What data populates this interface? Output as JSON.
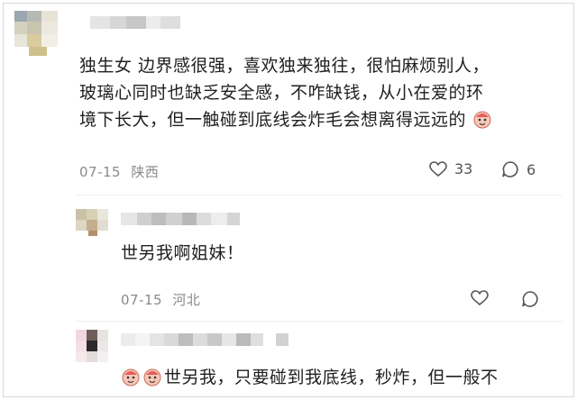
{
  "comment1": {
    "lines": [
      "独生女 边界感很强，喜欢独来独往，很怕麻烦别人，",
      "玻璃心同时也缺乏安全感，不咋缺钱，从小在爱的环",
      "境下长大，但一触碰到底线会炸毛会想离得远远的"
    ],
    "emoji": "face-emoji",
    "date": "07-15",
    "location": "陕西",
    "like_icon": "heart-icon",
    "like_count": "33",
    "reply_icon": "comment-bubble-icon",
    "reply_count": "6"
  },
  "reply1": {
    "text": "世另我啊姐妹！",
    "date": "07-15",
    "location": "河北",
    "like_icon": "heart-icon",
    "reply_icon": "comment-bubble-icon"
  },
  "comment2": {
    "emoji": "face-emoji",
    "text": "世另我，只要碰到我底线，秒炸，但一般不"
  },
  "colors": {
    "text": "#1f1f1f",
    "meta": "#8a8a8a",
    "divider": "#eeeeee",
    "frame": "#d9d9d9"
  }
}
